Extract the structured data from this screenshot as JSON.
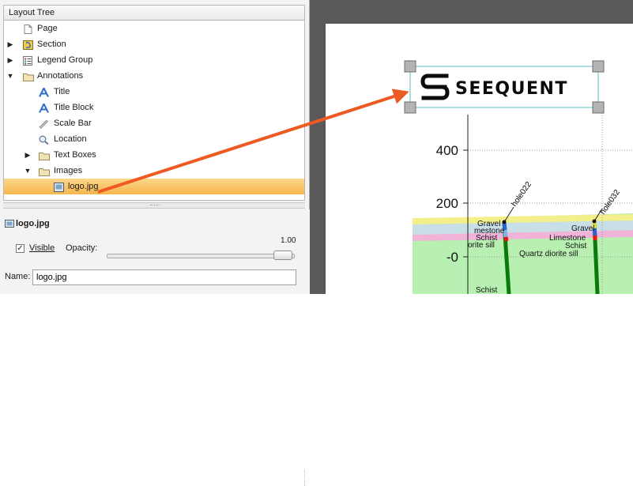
{
  "layout_tree": {
    "header": "Layout Tree",
    "items": [
      {
        "label": "Page",
        "icon": "page-icon",
        "expander": "",
        "selected": false
      },
      {
        "label": "Section",
        "icon": "section-icon",
        "expander": "▶",
        "selected": false
      },
      {
        "label": "Legend Group",
        "icon": "legend-icon",
        "expander": "▶",
        "selected": false
      },
      {
        "label": "Annotations",
        "icon": "folder-icon",
        "expander": "▼",
        "selected": false
      },
      {
        "label": "Title",
        "icon": "text-a-icon",
        "expander": "",
        "selected": false
      },
      {
        "label": "Title Block",
        "icon": "text-a-icon",
        "expander": "",
        "selected": false
      },
      {
        "label": "Scale Bar",
        "icon": "ruler-icon",
        "expander": "",
        "selected": false
      },
      {
        "label": "Location",
        "icon": "magnifier-icon",
        "expander": "",
        "selected": false
      },
      {
        "label": "Text Boxes",
        "icon": "folder-icon",
        "expander": "▶",
        "selected": false
      },
      {
        "label": "Images",
        "icon": "folder-icon",
        "expander": "▼",
        "selected": false
      },
      {
        "label": "logo.jpg",
        "icon": "image-icon",
        "expander": "",
        "selected": true
      }
    ]
  },
  "properties": {
    "title": "logo.jpg",
    "visible_label": "Visible",
    "visible_checked": true,
    "opacity_label": "Opacity:",
    "opacity_value": "1.00",
    "opacity": 1.0,
    "name_label": "Name:",
    "name_value": "logo.jpg"
  },
  "logo": {
    "text": "SEEQUENT"
  },
  "chart_data": {
    "type": "scatter",
    "y_ticks": [
      "400",
      "200",
      "-0"
    ],
    "hole_labels": [
      "hole022",
      "hole032"
    ],
    "unit_labels": [
      {
        "text": "Gravel"
      },
      {
        "text": "mestone"
      },
      {
        "text": "Schist"
      },
      {
        "text": "orite sill"
      },
      {
        "text": "Gravel"
      },
      {
        "text": "Limestone"
      },
      {
        "text": "Schist"
      },
      {
        "text": "Quartz diorite sill"
      },
      {
        "text": "Schist"
      }
    ]
  },
  "colors": {
    "canvas_bg": "#595959",
    "selection": "#f6b64d",
    "arrow": "#ee5a24",
    "logo_frame": "#8fd3d3",
    "gravel": "#f3ef8a",
    "limestone": "#c9dfe7",
    "schist": "#b7e6b0",
    "sill": "#f2b3d9"
  }
}
